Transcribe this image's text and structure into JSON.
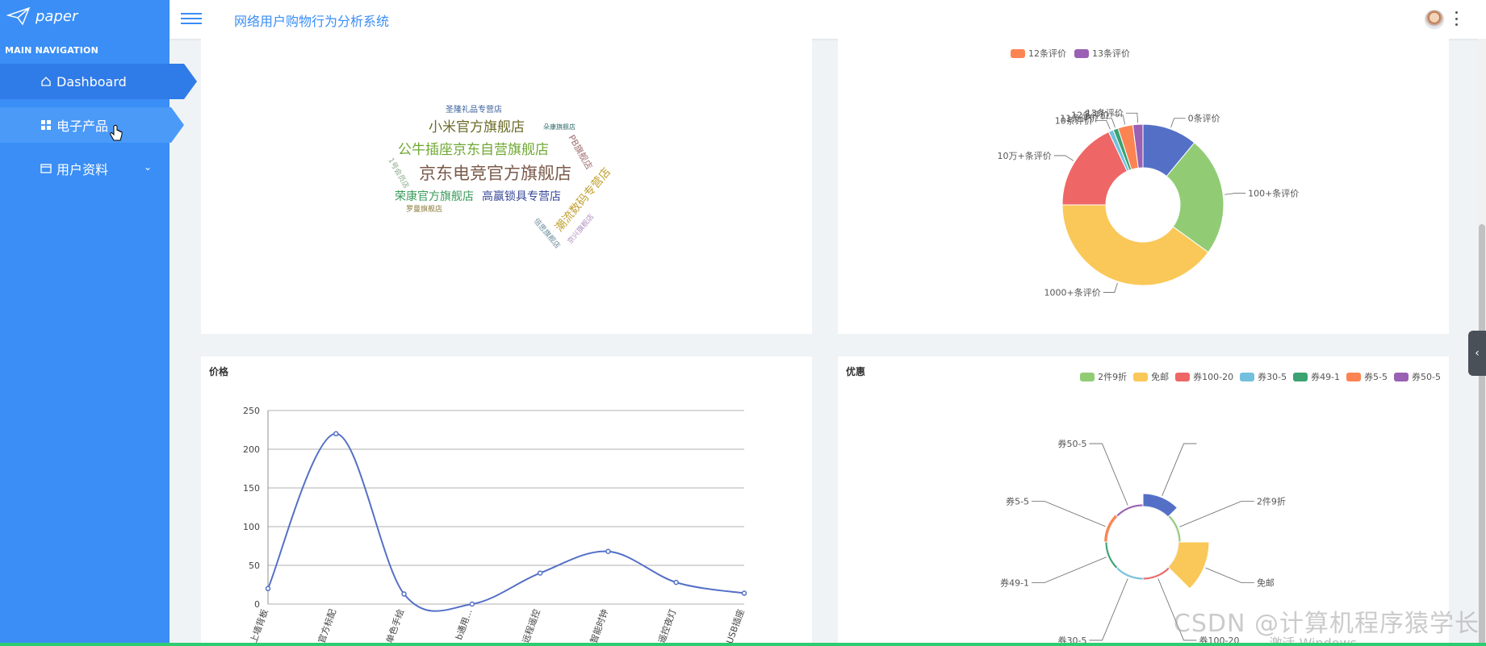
{
  "app": {
    "brand": "paper",
    "system_title": "网络用户购物行为分析系统"
  },
  "sidebar": {
    "section_title": "MAIN NAVIGATION",
    "items": [
      {
        "label": "Dashboard",
        "icon": "home-icon"
      },
      {
        "label": "电子产品",
        "icon": "grid-icon"
      },
      {
        "label": "用户资料",
        "icon": "card-icon"
      }
    ]
  },
  "wordcloud": {
    "words": [
      {
        "text": "圣隆礼品专营店",
        "color": "#3a5f9a"
      },
      {
        "text": "小米官方旗舰店",
        "color": "#6b6b2a"
      },
      {
        "text": "朵康旗舰店",
        "color": "#2f6a6a"
      },
      {
        "text": "公牛插座京东自营旗舰店",
        "color": "#6fa832"
      },
      {
        "text": "PB旗舰店",
        "color": "#a07070"
      },
      {
        "text": "1号会员店",
        "color": "#8aaa8a"
      },
      {
        "text": "京东电竞官方旗舰店",
        "color": "#7a5a4a"
      },
      {
        "text": "荣康官方旗舰店",
        "color": "#3a9a5a"
      },
      {
        "text": "高赢锁具专营店",
        "color": "#3a4a9a"
      },
      {
        "text": "罗曼旗舰店",
        "color": "#8a7a3a"
      },
      {
        "text": "潮流数码专营店",
        "color": "#c0a030"
      },
      {
        "text": "倍思旗舰店",
        "color": "#6a8a9a"
      },
      {
        "text": "京兴旗舰店",
        "color": "#b090c0"
      }
    ]
  },
  "comments_chart": {
    "legend": [
      "12条评价",
      "13条评价"
    ]
  },
  "price_panel": {
    "title": "价格"
  },
  "discount_panel": {
    "title": "优惠"
  },
  "chart_data": [
    {
      "type": "pie",
      "subtype": "donut",
      "slices": [
        {
          "name": "0条评价",
          "value": 11,
          "color": "#5470c6"
        },
        {
          "name": "100+条评价",
          "value": 24,
          "color": "#91cc75"
        },
        {
          "name": "1000+条评价",
          "value": 40,
          "color": "#fac858"
        },
        {
          "name": "10万+条评价",
          "value": 18,
          "color": "#ee6666"
        },
        {
          "name": "10条评价",
          "value": 1,
          "color": "#73c0de"
        },
        {
          "name": "11条评价",
          "value": 1,
          "color": "#3ba272"
        },
        {
          "name": "12条评价",
          "value": 3,
          "color": "#fc8452"
        },
        {
          "name": "13条评价",
          "value": 2,
          "color": "#9a60b4"
        }
      ]
    },
    {
      "type": "line",
      "smooth": true,
      "categories": [
        "上墙背板",
        "官方标配",
        "单色手绘",
        "b通用...",
        "远程遥控",
        "智能时钟",
        "遥控夜灯",
        "USB插座"
      ],
      "values": [
        20,
        220,
        13,
        0,
        40,
        68,
        28,
        14
      ],
      "ylim": [
        0,
        250
      ],
      "yticks": [
        0,
        50,
        100,
        150,
        200,
        250
      ],
      "color": "#5470c6"
    },
    {
      "type": "pie",
      "subtype": "rose",
      "legend": [
        "2件9折",
        "免邮",
        "券100-20",
        "券30-5",
        "券49-1",
        "券5-5",
        "券50-5"
      ],
      "slices": [
        {
          "name": "",
          "value": 8,
          "color": "#5470c6"
        },
        {
          "name": "2件9折",
          "value": 0.3,
          "color": "#91cc75"
        },
        {
          "name": "免邮",
          "value": 45,
          "color": "#fac858"
        },
        {
          "name": "券100-20",
          "value": 0.3,
          "color": "#ee6666"
        },
        {
          "name": "券30-5",
          "value": 0.3,
          "color": "#73c0de"
        },
        {
          "name": "券49-1",
          "value": 0.3,
          "color": "#3ba272"
        },
        {
          "name": "券5-5",
          "value": 0.6,
          "color": "#fc8452"
        },
        {
          "name": "券50-5",
          "value": 0.3,
          "color": "#9a60b4"
        }
      ]
    }
  ],
  "overlay": {
    "watermark": "CSDN @计算机程序猿学长",
    "activate": "激活 Windows"
  }
}
